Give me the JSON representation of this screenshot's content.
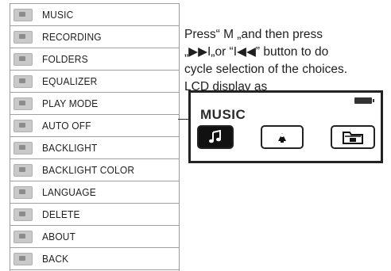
{
  "menu": {
    "items": [
      {
        "label": "MUSIC",
        "icon": "music-icon"
      },
      {
        "label": "RECORDING",
        "icon": "recording-icon"
      },
      {
        "label": "FOLDERS",
        "icon": "folders-icon"
      },
      {
        "label": "EQUALIZER",
        "icon": "equalizer-icon"
      },
      {
        "label": "PLAY MODE",
        "icon": "play-mode-icon"
      },
      {
        "label": "AUTO OFF",
        "icon": "auto-off-icon"
      },
      {
        "label": "BACKLIGHT",
        "icon": "backlight-icon"
      },
      {
        "label": "BACKLIGHT COLOR",
        "icon": "backlight-color-icon"
      },
      {
        "label": "LANGUAGE",
        "icon": "language-icon"
      },
      {
        "label": "DELETE",
        "icon": "delete-icon"
      },
      {
        "label": "ABOUT",
        "icon": "about-icon"
      },
      {
        "label": "BACK",
        "icon": "back-icon"
      }
    ]
  },
  "description": {
    "lines": [
      "Press“ M „and then press",
      "„▶▶I„or “I◀◀” button to do",
      "cycle selection of the choices.",
      "LCD display as"
    ]
  },
  "lcd": {
    "title": "MUSIC",
    "icons": [
      "music-note-icon",
      "recording-icon",
      "folder-icon"
    ],
    "selected_index": 0,
    "battery": "battery-icon"
  }
}
